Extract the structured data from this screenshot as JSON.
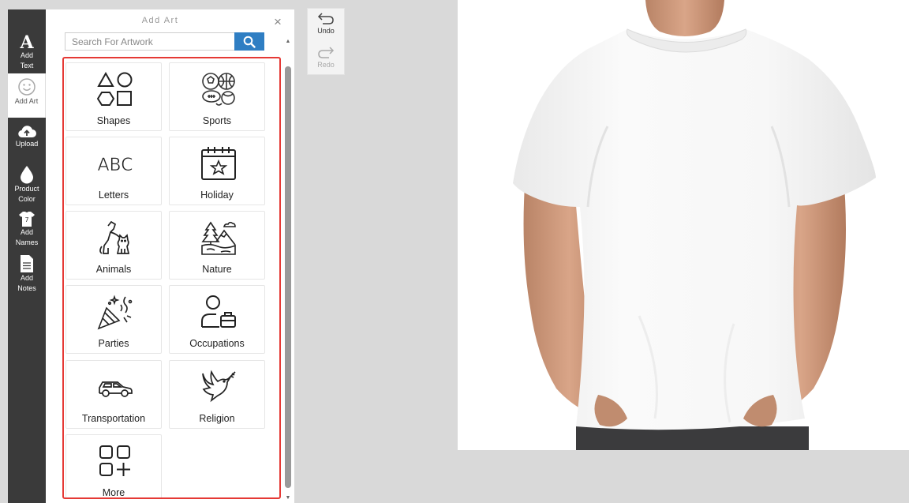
{
  "toolbar": {
    "items": [
      {
        "label_1": "Add",
        "label_2": "Text",
        "icon": "letter-a-icon"
      },
      {
        "label_1": "Add Art",
        "label_2": "",
        "icon": "smiley-icon"
      },
      {
        "label_1": "Upload",
        "label_2": "",
        "icon": "cloud-upload-icon"
      },
      {
        "label_1": "Product",
        "label_2": "Color",
        "icon": "drop-icon"
      },
      {
        "label_1": "Add",
        "label_2": "Names",
        "icon": "jersey-icon"
      },
      {
        "label_1": "Add",
        "label_2": "Notes",
        "icon": "document-icon"
      }
    ]
  },
  "panel": {
    "title": "Add Art",
    "close": "×",
    "search": {
      "placeholder": "Search For Artwork"
    },
    "categories": [
      {
        "label": "Shapes",
        "icon": "shapes-icon"
      },
      {
        "label": "Sports",
        "icon": "sports-balls-icon"
      },
      {
        "label": "Letters",
        "icon": "abc-icon"
      },
      {
        "label": "Holiday",
        "icon": "calendar-icon"
      },
      {
        "label": "Animals",
        "icon": "dog-cat-icon"
      },
      {
        "label": "Nature",
        "icon": "mountain-tree-icon"
      },
      {
        "label": "Parties",
        "icon": "party-popper-icon"
      },
      {
        "label": "Occupations",
        "icon": "person-briefcase-icon"
      },
      {
        "label": "Transportation",
        "icon": "car-icon"
      },
      {
        "label": "Religion",
        "icon": "dove-icon"
      },
      {
        "label": "More",
        "icon": "grid-plus-icon"
      }
    ]
  },
  "history": {
    "undo": "Undo",
    "redo": "Redo"
  },
  "colors": {
    "accent": "#2f7ec3",
    "highlight": "#e53935",
    "toolbar": "#3a3a3a"
  }
}
